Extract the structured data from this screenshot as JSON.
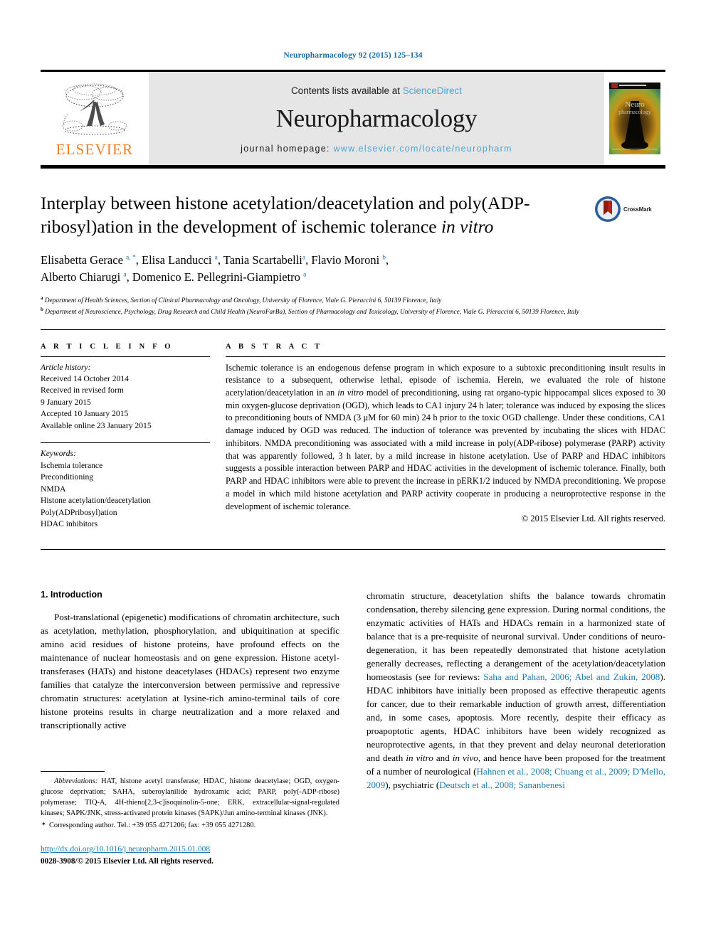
{
  "running_head": "Neuropharmacology 92 (2015) 125–134",
  "masthead": {
    "publisher_logo_text": "ELSEVIER",
    "contents_prefix": "Contents lists available at ",
    "contents_link": "ScienceDirect",
    "journal_title": "Neuropharmacology",
    "homepage_prefix": "journal homepage: ",
    "homepage_url": "www.elsevier.com/locate/neuropharm",
    "cover_title_line1": "Neuro",
    "cover_title_line2": "pharmacology"
  },
  "article": {
    "title_part1": "Interplay between histone acetylation/deacetylation and poly(ADP-ribosyl)ation in the development of ischemic tolerance ",
    "title_italic": "in vitro",
    "crossmark_label": "CrossMark",
    "authors_line1": "Elisabetta Gerace ",
    "authors": "Elisabetta Gerace a, *, Elisa Landucci a, Tania Scartabelli a, Flavio Moroni b, Alberto Chiarugi a, Domenico E. Pellegrini-Giampietro a",
    "affiliation_a": "Department of Health Sciences, Section of Clinical Pharmacology and Oncology, University of Florence, Viale G. Pieraccini 6, 50139 Florence, Italy",
    "affiliation_b": "Department of Neuroscience, Psychology, Drug Research and Child Health (NeuroFarBa), Section of Pharmacology and Toxicology, University of Florence, Viale G. Pieraccini 6, 50139 Florence, Italy"
  },
  "article_info": {
    "label": "A R T I C L E   I N F O",
    "history_head": "Article history:",
    "history_lines": [
      "Received 14 October 2014",
      "Received in revised form",
      "9 January 2015",
      "Accepted 10 January 2015",
      "Available online 23 January 2015"
    ],
    "keywords_head": "Keywords:",
    "keywords": [
      "Ischemia tolerance",
      "Preconditioning",
      "NMDA",
      "Histone acetylation/deacetylation",
      "Poly(ADPribosyl)ation",
      "HDAC inhibitors"
    ]
  },
  "abstract": {
    "label": "A B S T R A C T",
    "text_1": "Ischemic tolerance is an endogenous defense program in which exposure to a subtoxic preconditioning insult results in resistance to a subsequent, otherwise lethal, episode of ischemia. Herein, we evaluated the role of histone acetylation/deacetylation in an ",
    "italic_1": "in vitro",
    "text_2": " model of preconditioning, using rat organo-typic hippocampal slices exposed to 30 min oxygen-glucose deprivation (OGD), which leads to CA1 injury 24 h later; tolerance was induced by exposing the slices to preconditioning bouts of NMDA (3 μM for 60 min) 24 h prior to the toxic OGD challenge. Under these conditions, CA1 damage induced by OGD was reduced. The induction of tolerance was prevented by incubating the slices with HDAC inhibitors. NMDA preconditioning was associated with a mild increase in poly(ADP-ribose) polymerase (PARP) activity that was apparently followed, 3 h later, by a mild increase in histone acetylation. Use of PARP and HDAC inhibitors suggests a possible interaction between PARP and HDAC activities in the development of ischemic tolerance. Finally, both PARP and HDAC inhibitors were able to prevent the increase in pERK1/2 induced by NMDA preconditioning. We propose a model in which mild histone acetylation and PARP activity cooperate in producing a neuroprotective response in the development of ischemic tolerance.",
    "copyright": "© 2015 Elsevier Ltd. All rights reserved."
  },
  "introduction": {
    "heading": "1. Introduction",
    "left_paragraph": "Post-translational (epigenetic) modifications of chromatin architecture, such as acetylation, methylation, phosphorylation, and ubiquitination at specific amino acid residues of histone proteins, have profound effects on the maintenance of nuclear homeostasis and on gene expression. Histone acetyl-transferases (HATs) and histone deacetylases (HDACs) represent two enzyme families that catalyze the interconversion between permissive and repressive chromatin structures: acetylation at lysine-rich amino-terminal tails of core histone proteins results in charge neutralization and a more relaxed and transcriptionally active",
    "right_text_1": "chromatin structure, deacetylation shifts the balance towards chromatin condensation, thereby silencing gene expression. During normal conditions, the enzymatic activities of HATs and HDACs remain in a harmonized state of balance that is a pre-requisite of neuronal survival. Under conditions of neuro-degeneration, it has been repeatedly demonstrated that histone acetylation generally decreases, reflecting a derangement of the acetylation/deacetylation homeostasis (see for reviews: ",
    "right_ref_1": "Saha and Pahan, 2006; Abel and Zukin, 2008",
    "right_text_2": "). HDAC inhibitors have initially been proposed as effective therapeutic agents for cancer, due to their remarkable induction of growth arrest, differentiation and, in some cases, apoptosis. More recently, despite their efficacy as proapoptotic agents, HDAC inhibitors have been widely recognized as neuroprotective agents, in that they prevent and delay neuronal deterioration and death ",
    "right_italic_1": "in vitro",
    "right_text_3": " and ",
    "right_italic_2": "in vivo",
    "right_text_4": ", and hence have been proposed for the treatment of a number of neurological (",
    "right_ref_2": "Hahnen et al., 2008; Chuang et al., 2009; D'Mello, 2009",
    "right_text_5": "), psychiatric (",
    "right_ref_3": "Deutsch et al., 2008; Sananbenesi"
  },
  "footnotes": {
    "abbrev_label": "Abbreviations:",
    "abbrev_text": " HAT, histone acetyl transferase; HDAC, histone deacetylase; OGD, oxygen-glucose deprivation; SAHA, suberoylanilide hydroxamic acid; PARP, poly(-ADP-ribose) polymerase; TIQ-A, 4H-thieno[2,3-c]isoquinolin-5-one; ERK, extracellular-signal-regulated kinases; SAPK/JNK, stress-activated protein kinases (SAPK)/Jun amino-terminal kinases (JNK).",
    "corresponding": "Corresponding author. Tel.: +39 055 4271206; fax: +39 055 4271280.",
    "doi": "http://dx.doi.org/10.1016/j.neuropharm.2015.01.008",
    "issn": "0028-3908/© 2015 Elsevier Ltd. All rights reserved."
  },
  "colors": {
    "link_blue": "#1a7bb0",
    "sciencedirect_blue": "#4da3d4",
    "elsevier_orange": "#ec7e25",
    "running_head_blue": "#1a6fa8"
  }
}
